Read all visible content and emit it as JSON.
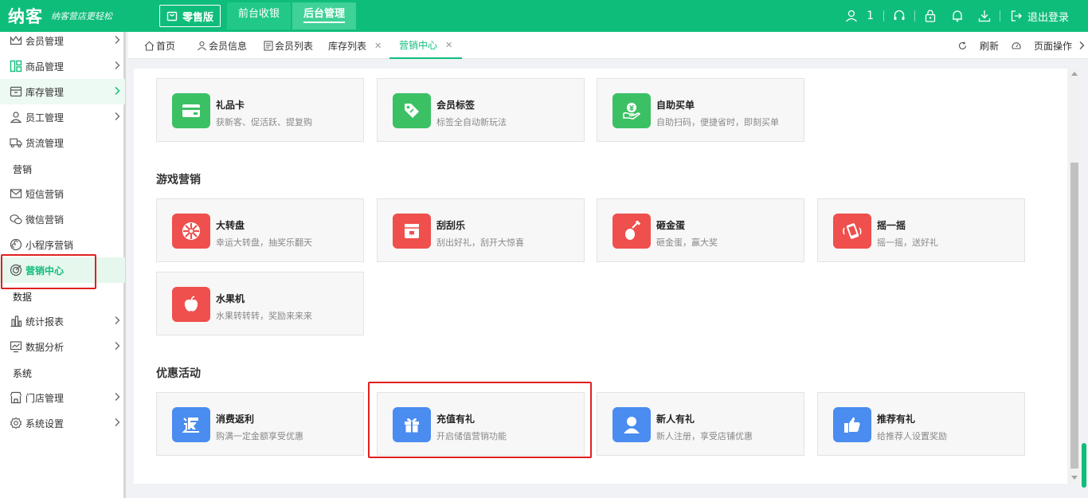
{
  "brand": {
    "logo": "纳客",
    "slogan": "纳客营店更轻松",
    "edition": "零售版",
    "accent": "#0fbd7a"
  },
  "top_nav": [
    {
      "label": "前台收银",
      "active": false
    },
    {
      "label": "后台管理",
      "active": true
    }
  ],
  "header_right": {
    "user_count": "1",
    "logout": "退出登录"
  },
  "sidebar": {
    "items": [
      {
        "label": "会员管理",
        "icon": "crown-icon"
      },
      {
        "label": "商品管理",
        "icon": "grid-icon"
      },
      {
        "label": "库存管理",
        "icon": "box-icon"
      },
      {
        "label": "员工管理",
        "icon": "user-icon"
      },
      {
        "label": "货流管理",
        "icon": "truck-icon"
      },
      {
        "label": "短信营销",
        "icon": "mail-icon"
      },
      {
        "label": "微信营销",
        "icon": "wechat-icon"
      },
      {
        "label": "小程序营销",
        "icon": "miniprogram-icon"
      },
      {
        "label": "营销中心",
        "icon": "target-icon"
      },
      {
        "label": "统计报表",
        "icon": "bar-chart-icon"
      },
      {
        "label": "数据分析",
        "icon": "monitor-chart-icon"
      },
      {
        "label": "门店管理",
        "icon": "store-icon"
      },
      {
        "label": "系统设置",
        "icon": "gear-icon"
      }
    ],
    "groups": [
      "营销",
      "数据",
      "系统"
    ]
  },
  "tabs": [
    {
      "label": "首页",
      "icon": "home-icon"
    },
    {
      "label": "会员信息",
      "icon": "user-icon"
    },
    {
      "label": "会员列表",
      "icon": "list-icon"
    },
    {
      "label": "库存列表",
      "closable": true
    },
    {
      "label": "营销中心",
      "closable": true,
      "active": true
    }
  ],
  "tab_tools": {
    "refresh": "刷新",
    "page_ops": "页面操作"
  },
  "sections": {
    "top_cards": [
      {
        "title": "礼品卡",
        "desc": "获新客、促活跃、提复购",
        "icon": "card-icon",
        "color": "#3cc064"
      },
      {
        "title": "会员标签",
        "desc": "标签全自动新玩法",
        "icon": "tag-icon",
        "color": "#3cc064"
      },
      {
        "title": "自助买单",
        "desc": "自助扫码，便捷省时，即刻买单",
        "icon": "yen-hand-icon",
        "color": "#3cc064"
      }
    ],
    "games": {
      "title": "游戏营销",
      "cards": [
        {
          "title": "大转盘",
          "desc": "幸运大转盘，抽奖乐翻天",
          "icon": "wheel-icon",
          "color": "#ef4f4d"
        },
        {
          "title": "刮刮乐",
          "desc": "刮出好礼，刮开大惊喜",
          "icon": "scratch-icon",
          "color": "#ef4f4d"
        },
        {
          "title": "砸金蛋",
          "desc": "砸金蛋，赢大奖",
          "icon": "hammer-egg-icon",
          "color": "#ef4f4d"
        },
        {
          "title": "摇一摇",
          "desc": "摇一摇，送好礼",
          "icon": "shake-phone-icon",
          "color": "#ef4f4d"
        },
        {
          "title": "水果机",
          "desc": "水果转转转，奖励来来来",
          "icon": "apple-icon",
          "color": "#ef4f4d"
        }
      ]
    },
    "promos": {
      "title": "优惠活动",
      "cards": [
        {
          "title": "消费返利",
          "desc": "购满一定金额享受优惠",
          "icon": "rebate-icon",
          "color": "#4a8cf0"
        },
        {
          "title": "充值有礼",
          "desc": "开启储值营销功能",
          "icon": "gift-icon",
          "color": "#4a8cf0"
        },
        {
          "title": "新人有礼",
          "desc": "新人注册，享受店铺优惠",
          "icon": "new-user-icon",
          "color": "#4a8cf0"
        },
        {
          "title": "推荐有礼",
          "desc": "给推荐人设置奖励",
          "icon": "thumbs-up-icon",
          "color": "#4a8cf0"
        }
      ]
    }
  }
}
